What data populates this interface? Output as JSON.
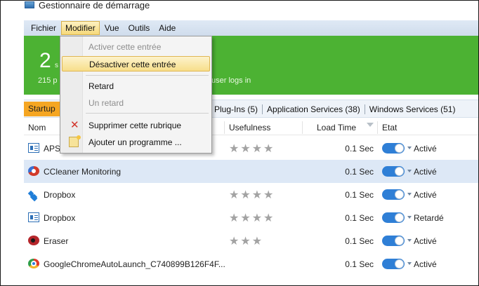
{
  "window": {
    "title": "Gestionnaire de démarrage"
  },
  "menubar": [
    "Fichier",
    "Modifier",
    "Vue",
    "Outils",
    "Aide"
  ],
  "banner": {
    "count": "2",
    "count_suffix": "s",
    "sub_left": "215 p",
    "sub_right": "user logs in",
    "color": "#4cb233"
  },
  "tabs": {
    "startup": "Startup",
    "others": [
      "Plug-Ins (5)",
      "Application Services (38)",
      "Windows Services (51)"
    ]
  },
  "columns": {
    "name": "Nom",
    "usefulness": "Usefulness",
    "load_time": "Load Time",
    "state": "Etat"
  },
  "rows": [
    {
      "icon": "apsl-icon",
      "name": "APSL",
      "stars": "★★★★",
      "load": "0.1 Sec",
      "status": "Activé",
      "selected": false
    },
    {
      "icon": "ccleaner-icon",
      "name": "CCleaner Monitoring",
      "stars": "",
      "load": "0.1 Sec",
      "status": "Activé",
      "selected": true
    },
    {
      "icon": "dropbox-icon",
      "name": "Dropbox",
      "stars": "★★★★",
      "load": "0.1 Sec",
      "status": "Activé",
      "selected": false
    },
    {
      "icon": "apsl-icon",
      "name": "Dropbox",
      "stars": "★★★★",
      "load": "0.1 Sec",
      "status": "Retardé",
      "selected": false
    },
    {
      "icon": "eraser-icon",
      "name": "Eraser",
      "stars": "★★★",
      "load": "0.1 Sec",
      "status": "Activé",
      "selected": false
    },
    {
      "icon": "chrome-icon",
      "name": "GoogleChromeAutoLaunch_C740899B126F4F...",
      "stars": "",
      "load": "0.1 Sec",
      "status": "Activé",
      "selected": false
    }
  ],
  "dropdown": {
    "activate": "Activer cette entrée",
    "deactivate": "Désactiver cette entrée",
    "delay": "Retard",
    "undelay": "Un retard",
    "delete": "Supprimer cette rubrique",
    "add": "Ajouter un programme ..."
  },
  "colors": {
    "accent_tab": "#f5a623",
    "toggle": "#2f7fd6",
    "selection": "#dde8f6"
  }
}
